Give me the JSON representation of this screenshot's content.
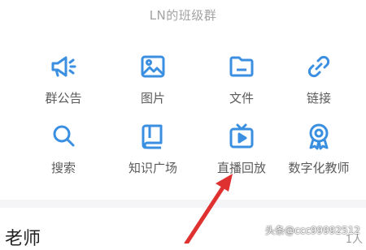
{
  "header": {
    "group_name": "LN的班级群"
  },
  "grid": {
    "items": [
      {
        "label": "群公告",
        "icon": "megaphone-icon"
      },
      {
        "label": "图片",
        "icon": "image-icon"
      },
      {
        "label": "文件",
        "icon": "folder-icon"
      },
      {
        "label": "链接",
        "icon": "link-icon"
      },
      {
        "label": "搜索",
        "icon": "search-icon"
      },
      {
        "label": "知识广场",
        "icon": "book-icon"
      },
      {
        "label": "直播回放",
        "icon": "tv-play-icon"
      },
      {
        "label": "数字化教师",
        "icon": "badge-icon"
      }
    ],
    "icon_color": "#3b8fe0"
  },
  "teachers": {
    "title": "老师",
    "count": "1人"
  },
  "watermark": {
    "text": "头条@ccc99992512"
  },
  "annotation": {
    "arrow_color": "#e03131"
  }
}
